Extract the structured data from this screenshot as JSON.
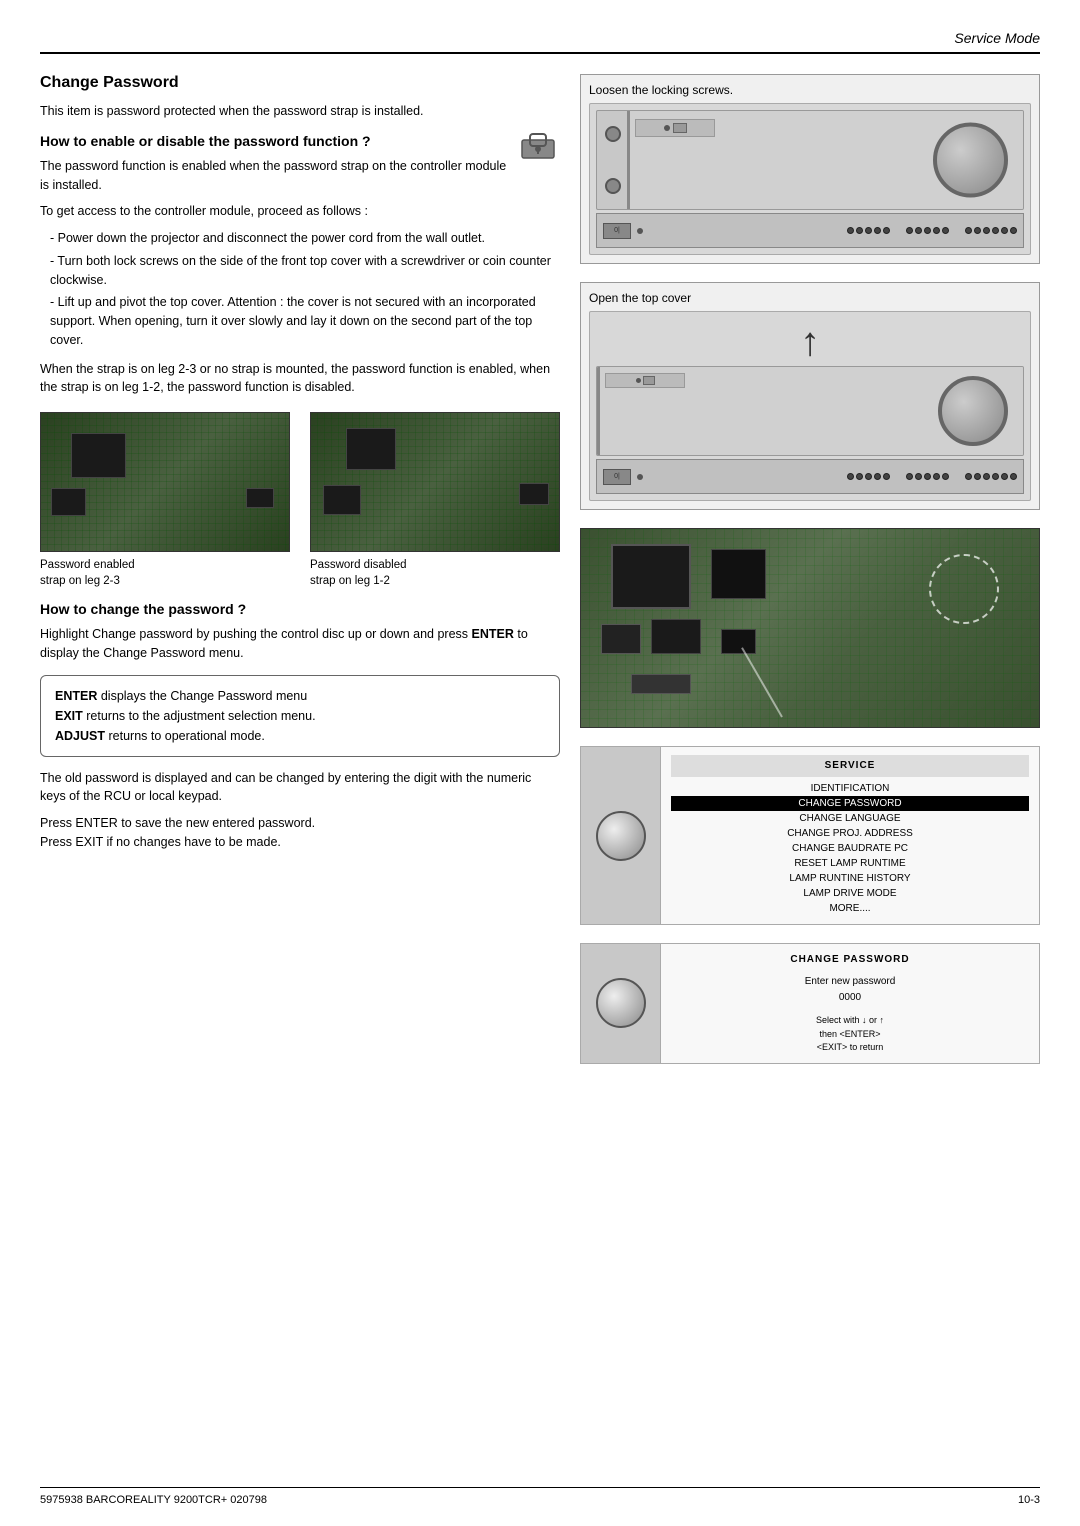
{
  "header": {
    "title": "Service Mode"
  },
  "section": {
    "title": "Change Password",
    "intro": "This item is password protected when the password strap is installed.",
    "subsection1": {
      "heading": "How to enable or disable the password function ?",
      "para1": "The password function is enabled when the password strap on the controller module is installed.",
      "para2": "To get access to the controller module, proceed as follows :",
      "steps": [
        "- Power down the projector and disconnect the power cord from the wall outlet.",
        "- Turn both lock screws on the side of the front top cover with a screwdriver or coin counter clockwise.",
        "- Lift up and pivot the top cover.  Attention : the cover is not secured with an incorporated support.  When opening, turn it over slowly and lay it down on the second part of the top cover."
      ]
    },
    "diagram1_label": "Loosen the locking screws.",
    "diagram2_label": "Open the top cover",
    "strap_note": "When the strap is on leg 2-3 or no strap is mounted, the password function is enabled, when the strap is on leg 1-2, the password function is disabled.",
    "photo1_caption": "Password enabled\nstrap on leg 2-3",
    "photo2_caption": "Password disabled\nstrap  on leg 1-2",
    "subsection2": {
      "heading": "How to change the password ?",
      "para1": "Highlight Change password by pushing the control disc up or down and press ENTER to display the Change Password menu.",
      "info_box": {
        "line1_bold": "ENTER",
        "line1_text": " displays the Change Password menu",
        "line2_bold": "EXIT",
        "line2_text": " returns to the adjustment selection menu.",
        "line3_bold": "ADJUST",
        "line3_text": " returns to operational mode."
      },
      "para2": "The old password is displayed and can be changed by entering the digit with the numeric keys of the RCU or local keypad.",
      "para3": "Press ENTER to save the new entered password.\nPress EXIT if no changes have to be made."
    }
  },
  "service_menu": {
    "title": "SERVICE",
    "items": [
      "IDENTIFICATION",
      "CHANGE PASSWORD",
      "CHANGE LANGUAGE",
      "CHANGE PROJ. ADDRESS",
      "CHANGE BAUDRATE PC",
      "RESET LAMP RUNTIME",
      "LAMP RUNTINE HISTORY",
      "LAMP DRIVE MODE",
      "MORE...."
    ],
    "highlighted_item": "CHANGE PASSWORD"
  },
  "pw_change_menu": {
    "title": "CHANGE PASSWORD",
    "enter_label": "Enter new password",
    "value": "0000",
    "select_hint": "Select with ↓ or ↑\nthen <ENTER>\n<EXIT> to return"
  },
  "footer": {
    "left": "5975938 BARCOREALITY 9200TCR+ 020798",
    "right": "10-3"
  }
}
